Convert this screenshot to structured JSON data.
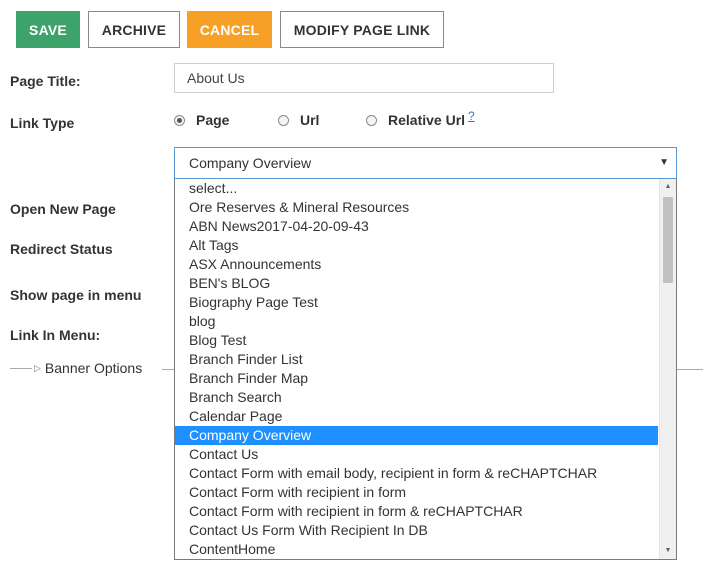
{
  "toolbar": {
    "save_label": "SAVE",
    "archive_label": "ARCHIVE",
    "cancel_label": "CANCEL",
    "modify_label": "MODIFY PAGE LINK"
  },
  "form": {
    "page_title_label": "Page Title:",
    "page_title_value": "About Us",
    "link_type_label": "Link Type",
    "link_type_options": [
      "Page",
      "Url",
      "Relative Url"
    ],
    "link_type_selected": "Page",
    "help_link": "?",
    "open_new_page_label": "Open New Page",
    "redirect_status_label": "Redirect Status",
    "show_in_menu_label": "Show page in menu",
    "link_in_menu_label": "Link In Menu:",
    "banner_options_label": "Banner Options"
  },
  "page_select": {
    "selected": "Company Overview",
    "options": [
      "select...",
      "Ore Reserves & Mineral Resources",
      "ABN News2017-04-20-09-43",
      "Alt Tags",
      "ASX Announcements",
      "BEN's BLOG",
      "Biography Page Test",
      "blog",
      "Blog Test",
      "Branch Finder List",
      "Branch Finder Map",
      "Branch Search",
      "Calendar Page",
      "Company Overview",
      "Contact Us",
      "Contact Form with email body, recipient in form & reCHAPTCHAR",
      "Contact Form with recipient in form",
      "Contact Form with recipient in form & reCHAPTCHAR",
      "Contact Us Form With Recipient In DB",
      "ContentHome"
    ],
    "highlighted_index": 13
  },
  "icons": {
    "select_arrow": "▼",
    "scroll_up": "▲",
    "scroll_down": "▼",
    "banner_expand": "▷"
  },
  "colors": {
    "save": "#3da36b",
    "cancel": "#f6a126",
    "highlight": "#1e90ff",
    "focus_border": "#5a9bd5"
  }
}
